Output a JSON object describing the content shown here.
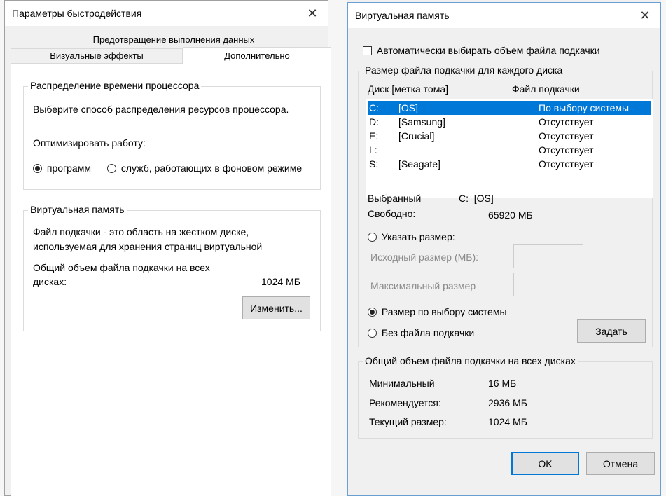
{
  "perf_dialog": {
    "title": "Параметры быстродействия",
    "close_glyph": "✕",
    "tabs": {
      "dep": "Предотвращение выполнения данных",
      "visual": "Визуальные эффекты",
      "advanced": "Дополнительно"
    },
    "cpu_group": {
      "label": "Распределение времени процессора",
      "description": "Выберите способ распределения ресурсов процессора.",
      "optimize_label": "Оптимизировать работу:",
      "option_programs": "программ",
      "option_services": "служб, работающих в фоновом режиме",
      "selected": "programs"
    },
    "vm_group": {
      "label": "Виртуальная память",
      "description_line1": "Файл подкачки - это область на жестком диске,",
      "description_line2": "используемая для хранения страниц виртуальной",
      "total_line1": "Общий объем файла подкачки на всех",
      "total_line2": "дисках:",
      "total_value": "1024 МБ",
      "change_button": "Изменить..."
    }
  },
  "vm_dialog": {
    "title": "Виртуальная память",
    "close_glyph": "✕",
    "auto_checkbox": "Автоматически выбирать объем файла подкачки",
    "auto_checked": false,
    "drives_group": {
      "label": "Размер файла подкачки для каждого диска",
      "col_drive": "Диск [метка тома]",
      "col_pagefile": "Файл подкачки",
      "rows": [
        {
          "letter": "C:",
          "label": "[OS]",
          "pagefile": "По выбору системы",
          "selected": true
        },
        {
          "letter": "D:",
          "label": "[Samsung]",
          "pagefile": "Отсутствует",
          "selected": false
        },
        {
          "letter": "E:",
          "label": "[Crucial]",
          "pagefile": "Отсутствует",
          "selected": false
        },
        {
          "letter": "L:",
          "label": "",
          "pagefile": "Отсутствует",
          "selected": false
        },
        {
          "letter": "S:",
          "label": "[Seagate]",
          "pagefile": "Отсутствует",
          "selected": false
        }
      ],
      "selected_label": "Выбранный",
      "selected_value": "C:  [OS]",
      "free_label": "Свободно:",
      "free_value": "65920 МБ",
      "option_custom": "Указать размер:",
      "initial_size_label": "Исходный размер (МБ):",
      "max_size_label": "Максимальный размер",
      "option_system": "Размер по выбору системы",
      "option_none": "Без файла подкачки",
      "selected_option": "system",
      "set_button": "Задать"
    },
    "totals_group": {
      "label": "Общий объем файла подкачки на всех дисках",
      "min_label": "Минимальный",
      "min_value": "16 МБ",
      "recommended_label": "Рекомендуется:",
      "recommended_value": "2936 МБ",
      "current_label": "Текущий размер:",
      "current_value": "1024 МБ"
    },
    "ok_button": "OK",
    "cancel_button": "Отмена"
  },
  "colors": {
    "accent": "#0078d7",
    "dialog_bg": "#f0f0f0",
    "panel_bg": "#ffffff"
  }
}
